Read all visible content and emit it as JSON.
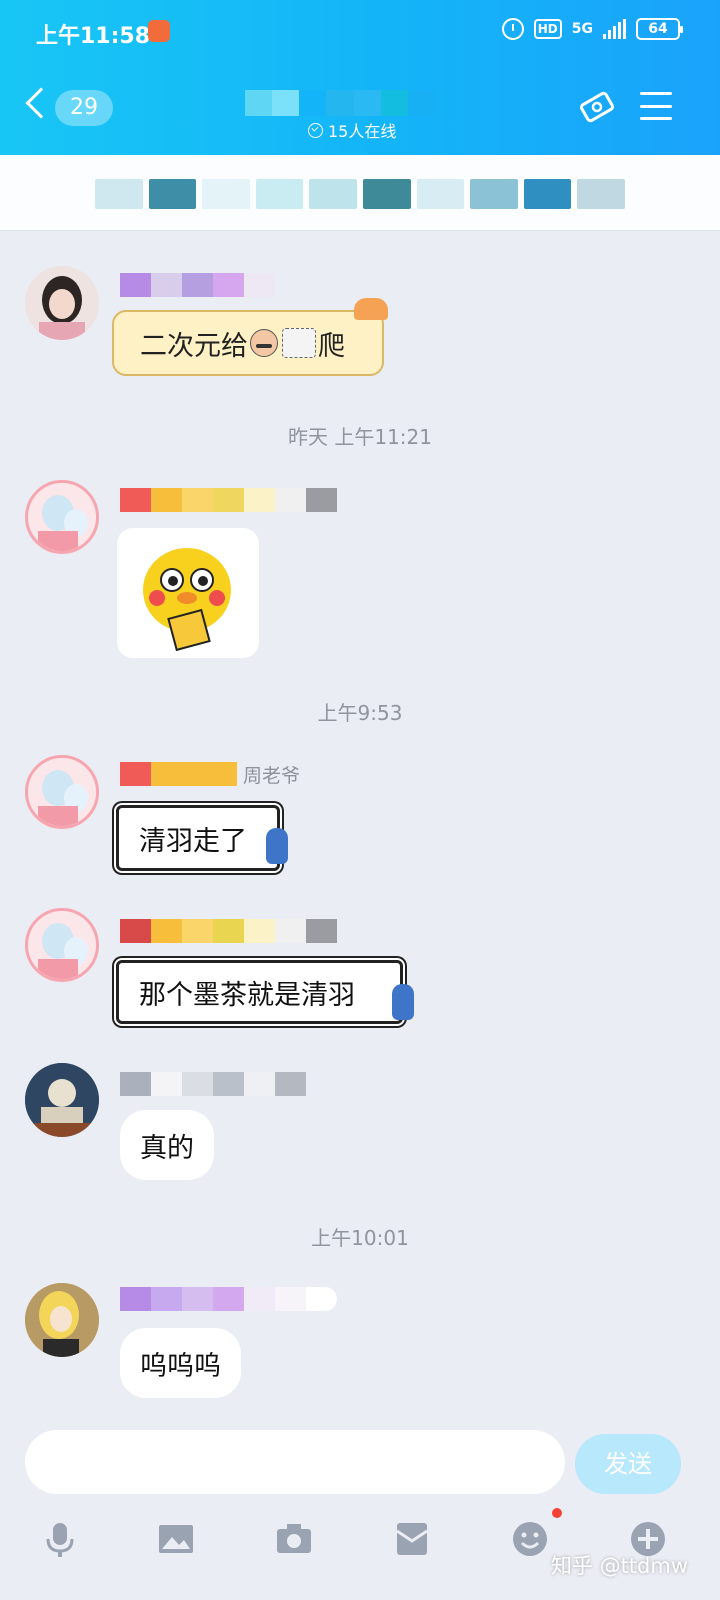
{
  "status_bar": {
    "time": "上午11:58",
    "network": "5G",
    "hd": "HD",
    "battery": "64"
  },
  "header": {
    "unread_count": "29",
    "online_text": "15人在线"
  },
  "messages": [
    {
      "type": "time",
      "text": "昨天 上午11:21"
    },
    {
      "type": "time",
      "text": "上午9:53"
    },
    {
      "type": "time",
      "text": "上午10:01"
    }
  ],
  "chat": {
    "msg1_before": "二次元给",
    "msg1_after": "爬",
    "msg3_sender_tail": "周老爷",
    "msg3_text": "清羽走了",
    "msg4_text": "那个墨茶就是清羽",
    "msg5_text": "真的",
    "msg6_text": "呜呜呜"
  },
  "input": {
    "send_label": "发送"
  },
  "watermark": "知乎 @ttdmw",
  "colors": {
    "header_start": "#18c6f5",
    "header_end": "#1aa3fb",
    "chat_bg": "#eaedf4"
  }
}
